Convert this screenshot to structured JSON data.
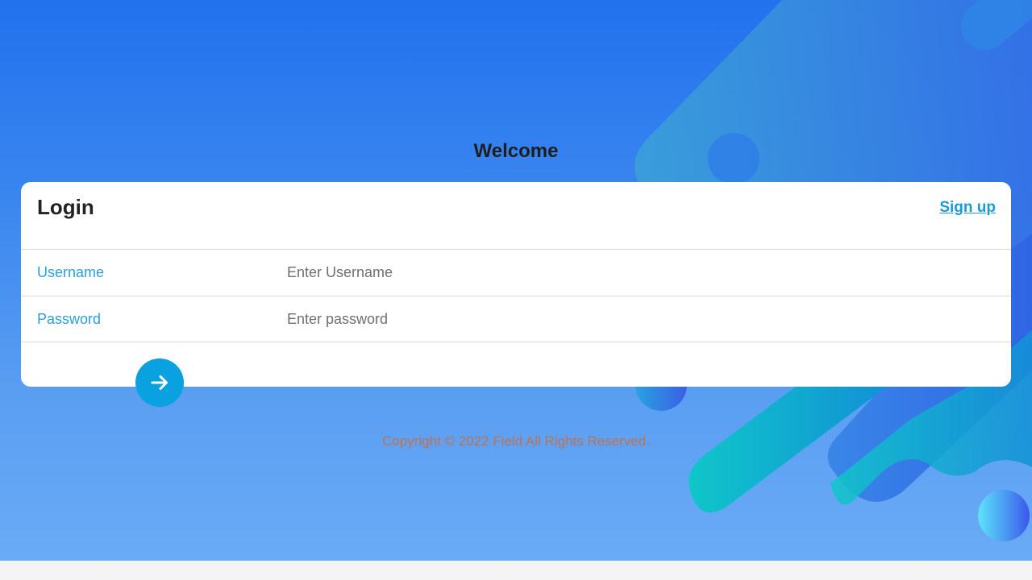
{
  "header": {
    "title": "Welcome"
  },
  "login_card": {
    "title": "Login",
    "signup_link": "Sign up",
    "fields": [
      {
        "label": "Username",
        "value": "",
        "placeholder": "Enter Username"
      },
      {
        "label": "Password",
        "value": "",
        "placeholder": "Enter password"
      }
    ],
    "submit_icon": "arrow-right-icon"
  },
  "footer": {
    "copyright": "Copyright © 2022 Field All Rights Reserved."
  },
  "colors": {
    "background_top": "#2271ee",
    "background_bottom": "#6aabf6",
    "accent": "#0aa1e0",
    "label": "#2a9fd6",
    "copyright": "#c0714f"
  }
}
